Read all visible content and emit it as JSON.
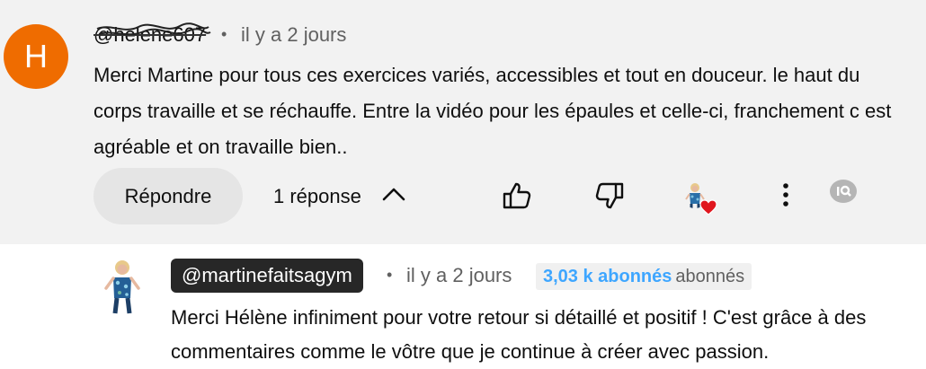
{
  "comment": {
    "avatar_letter": "H",
    "author": "@helene607",
    "dot": "•",
    "time": "il y a 2 jours",
    "text": "Merci Martine pour tous ces exercices variés, accessibles et tout en douceur. le haut du corps travaille et se réchauffe. Entre la vidéo pour les épaules et celle-ci, franchement c est agréable et on travaille bien..",
    "reply_label": "Répondre",
    "replies_label": "1 réponse",
    "icons": [
      "like-icon",
      "dislike-icon",
      "creator-heart-icon",
      "more-vert-icon",
      "ai-badge-icon"
    ]
  },
  "reply": {
    "author": "@martinefaitsagym",
    "dot": "•",
    "time": "il y a 2 jours",
    "subs_count": "3,03 k abonnés",
    "subs_word": "abonnés",
    "text": "Merci Hélène infiniment pour votre retour si détaillé et positif ! C'est grâce à des commentaires comme le vôtre que je continue à créer avec passion."
  },
  "colors": {
    "avatar_bg": "#ef6c00",
    "top_bg": "#f2f2f2",
    "accent_blue": "#3ea6ff",
    "heart": "#e0161e"
  }
}
